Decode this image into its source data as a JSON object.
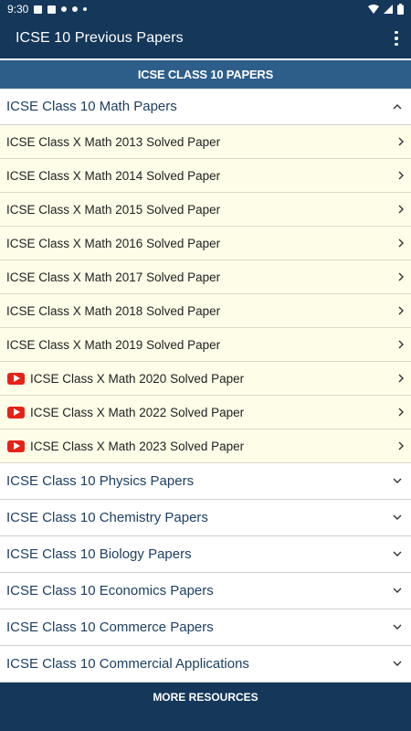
{
  "status_bar": {
    "time": "9:30"
  },
  "app_bar": {
    "title": "ICSE 10 Previous Papers"
  },
  "section": {
    "title": "ICSE CLASS 10 PAPERS"
  },
  "groups": [
    {
      "label": "ICSE Class 10 Math Papers",
      "expanded": true,
      "items": [
        {
          "label": "ICSE Class X Math 2013 Solved Paper",
          "video": false
        },
        {
          "label": "ICSE Class X Math 2014 Solved Paper",
          "video": false
        },
        {
          "label": "ICSE Class X Math 2015 Solved Paper",
          "video": false
        },
        {
          "label": "ICSE Class X Math 2016 Solved Paper",
          "video": false
        },
        {
          "label": "ICSE Class X Math 2017 Solved Paper",
          "video": false
        },
        {
          "label": "ICSE Class X Math 2018 Solved Paper",
          "video": false
        },
        {
          "label": "ICSE Class X Math 2019 Solved Paper",
          "video": false
        },
        {
          "label": "ICSE Class X Math 2020 Solved Paper",
          "video": true
        },
        {
          "label": "ICSE Class X Math 2022 Solved Paper",
          "video": true
        },
        {
          "label": "ICSE Class X Math 2023 Solved Paper",
          "video": true
        }
      ]
    },
    {
      "label": "ICSE Class 10 Physics Papers",
      "expanded": false,
      "items": []
    },
    {
      "label": "ICSE Class 10 Chemistry Papers",
      "expanded": false,
      "items": []
    },
    {
      "label": "ICSE Class 10 Biology Papers",
      "expanded": false,
      "items": []
    },
    {
      "label": "ICSE Class 10 Economics Papers",
      "expanded": false,
      "items": []
    },
    {
      "label": "ICSE Class 10 Commerce Papers",
      "expanded": false,
      "items": []
    },
    {
      "label": "ICSE Class 10 Commercial Applications",
      "expanded": false,
      "items": []
    }
  ],
  "bottom": {
    "label": "MORE RESOURCES"
  },
  "colors": {
    "primary": "#14375a",
    "section_header": "#2d5e8a",
    "sub_row_bg": "#fdfde8",
    "youtube_red": "#e62117"
  }
}
